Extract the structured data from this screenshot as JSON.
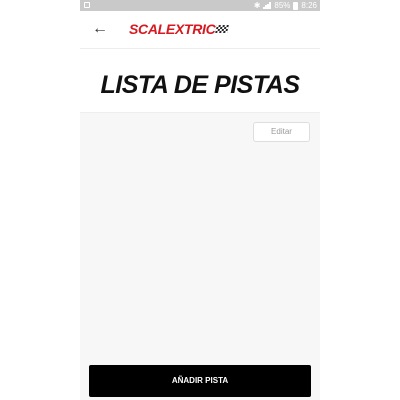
{
  "status_bar": {
    "battery_percent": "85%",
    "time": "8:26",
    "icons": [
      "gallery-icon",
      "bluetooth-icon",
      "signal-icon",
      "battery-icon"
    ]
  },
  "app_bar": {
    "logo_text": "SCALEXTRIC",
    "back_icon": "arrow-left-icon",
    "logo_color": "#d51920"
  },
  "page": {
    "title": "LISTA DE PISTAS"
  },
  "toolbar": {
    "edit_label": "Editar"
  },
  "footer": {
    "add_label": "AÑADIR PISTA"
  }
}
